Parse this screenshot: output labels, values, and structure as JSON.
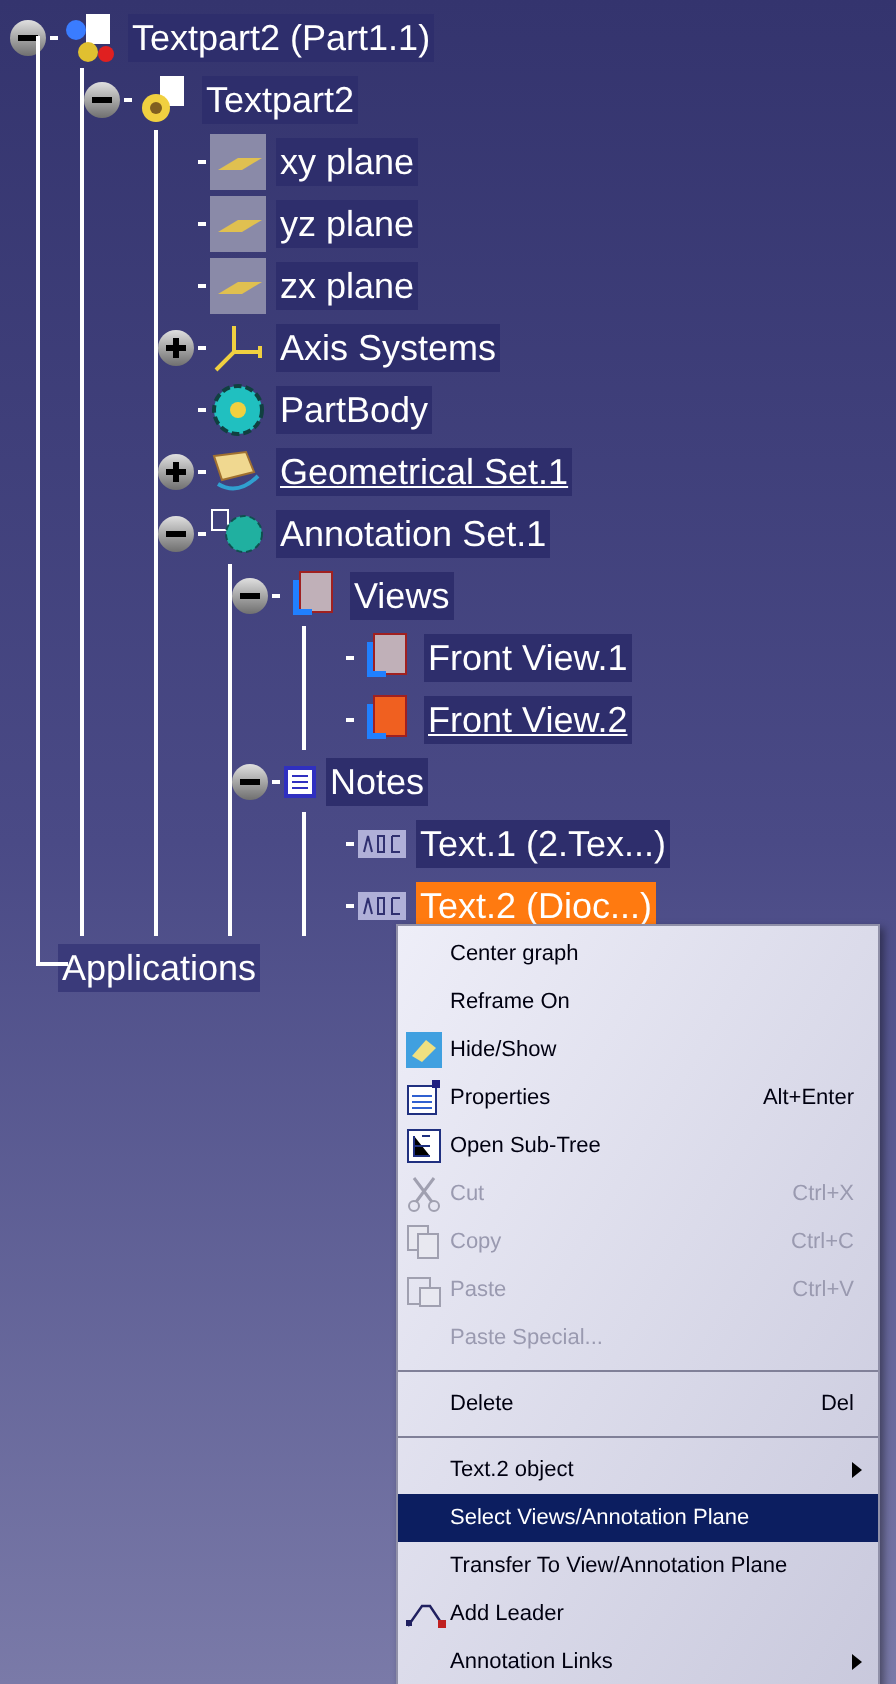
{
  "tree": [
    {
      "label": "Textpart2 (Part1.1)",
      "kind": "product",
      "expanded": true,
      "selected": false,
      "underlined": false,
      "children": [
        {
          "label": "Textpart2",
          "kind": "part",
          "expanded": true,
          "selected": false,
          "underlined": false,
          "children": [
            {
              "label": "xy plane",
              "kind": "plane",
              "selected": false,
              "underlined": false
            },
            {
              "label": "yz plane",
              "kind": "plane",
              "selected": false,
              "underlined": false
            },
            {
              "label": "zx plane",
              "kind": "plane",
              "selected": false,
              "underlined": false
            },
            {
              "label": "Axis Systems",
              "kind": "axis",
              "expanded": false,
              "selected": false,
              "underlined": false
            },
            {
              "label": "PartBody",
              "kind": "body",
              "selected": false,
              "underlined": false
            },
            {
              "label": "Geometrical Set.1",
              "kind": "geoset",
              "expanded": false,
              "selected": false,
              "underlined": true
            },
            {
              "label": "Annotation Set.1",
              "kind": "annotation",
              "expanded": true,
              "selected": false,
              "underlined": false,
              "children": [
                {
                  "label": "Views",
                  "kind": "views",
                  "expanded": true,
                  "selected": false,
                  "underlined": false,
                  "children": [
                    {
                      "label": "Front View.1",
                      "kind": "view",
                      "selected": false,
                      "underlined": false
                    },
                    {
                      "label": "Front View.2",
                      "kind": "view-active",
                      "selected": false,
                      "underlined": true
                    }
                  ]
                },
                {
                  "label": "Notes",
                  "kind": "notes",
                  "expanded": true,
                  "selected": false,
                  "underlined": false,
                  "children": [
                    {
                      "label": "Text.1 (2.Tex...)",
                      "kind": "text",
                      "selected": false,
                      "underlined": false
                    },
                    {
                      "label": "Text.2 (Dioc...)",
                      "kind": "text",
                      "selected": true,
                      "underlined": false
                    }
                  ]
                }
              ]
            }
          ]
        }
      ]
    },
    {
      "label": "Applications",
      "kind": "plain",
      "selected": false,
      "underlined": false
    }
  ],
  "context_menu": [
    {
      "kind": "item",
      "label": "Center graph",
      "disabled": false,
      "selected": false
    },
    {
      "kind": "item",
      "label": "Reframe On",
      "disabled": false,
      "selected": false
    },
    {
      "kind": "item",
      "label": "Hide/Show",
      "disabled": false,
      "selected": false
    },
    {
      "kind": "item",
      "label": "Properties",
      "shortcut": "Alt+Enter",
      "disabled": false,
      "selected": false
    },
    {
      "kind": "item",
      "label": "Open Sub-Tree",
      "disabled": false,
      "selected": false
    },
    {
      "kind": "item",
      "label": "Cut",
      "shortcut": "Ctrl+X",
      "disabled": true,
      "selected": false
    },
    {
      "kind": "item",
      "label": "Copy",
      "shortcut": "Ctrl+C",
      "disabled": true,
      "selected": false
    },
    {
      "kind": "item",
      "label": "Paste",
      "shortcut": "Ctrl+V",
      "disabled": true,
      "selected": false
    },
    {
      "kind": "item",
      "label": "Paste Special...",
      "disabled": true,
      "selected": false
    },
    {
      "kind": "separator"
    },
    {
      "kind": "item",
      "label": "Delete",
      "shortcut": "Del",
      "disabled": false,
      "selected": false
    },
    {
      "kind": "separator"
    },
    {
      "kind": "submenu",
      "label": "Text.2 object",
      "disabled": false,
      "selected": false
    },
    {
      "kind": "item",
      "label": "Select Views/Annotation Plane",
      "disabled": false,
      "selected": true
    },
    {
      "kind": "item",
      "label": "Transfer To View/Annotation Plane",
      "disabled": false,
      "selected": false
    },
    {
      "kind": "item",
      "label": "Add Leader",
      "disabled": false,
      "selected": false
    },
    {
      "kind": "submenu",
      "label": "Annotation Links",
      "disabled": false,
      "selected": false
    }
  ]
}
